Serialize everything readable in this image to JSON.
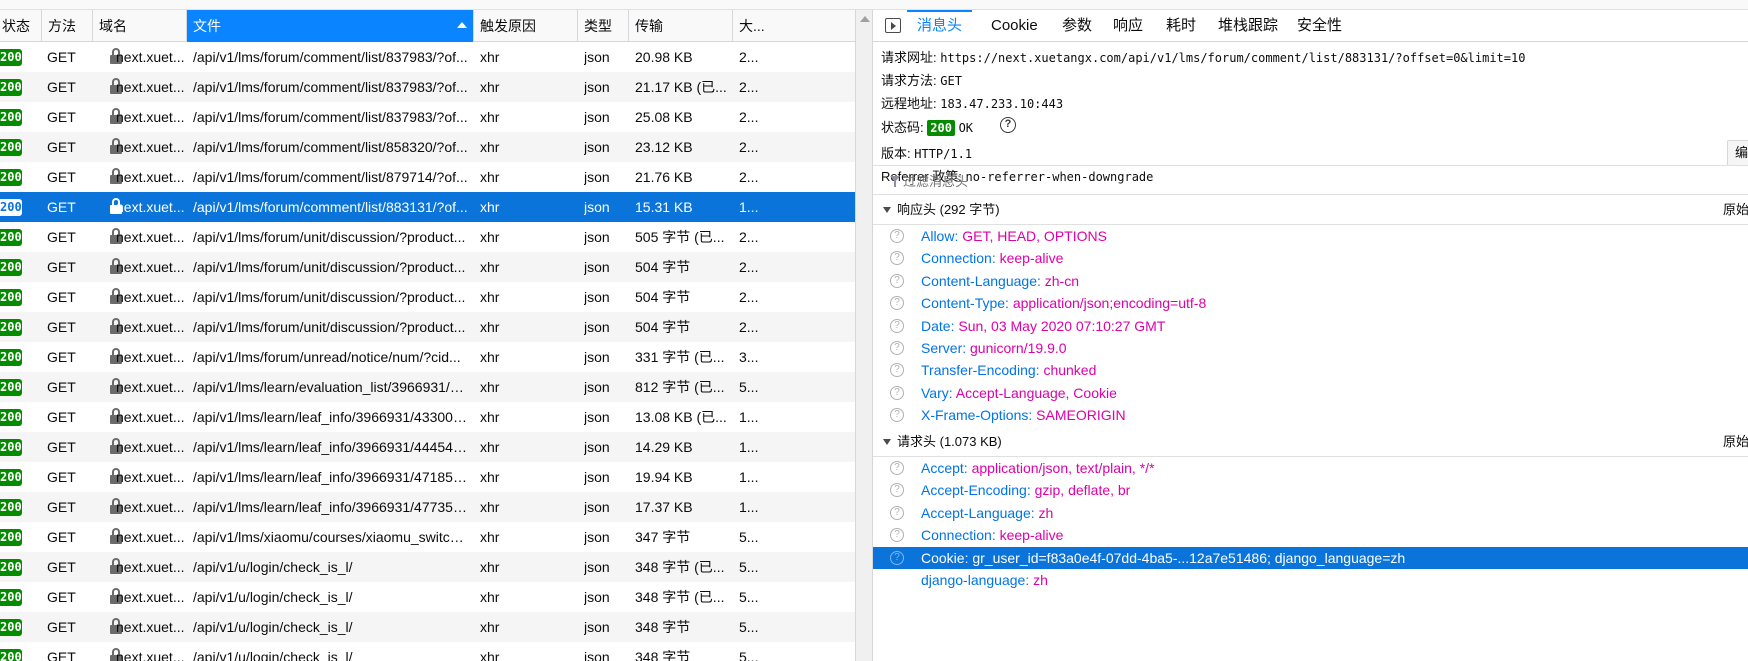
{
  "columns": [
    "状态",
    "方法",
    "域名",
    "文件",
    "触发原因",
    "类型",
    "传输",
    "大..."
  ],
  "requests": [
    {
      "status": "200",
      "method": "GET",
      "domain": "next.xuet...",
      "file": "/api/v1/lms/forum/comment/list/837983/?of...",
      "cause": "xhr",
      "type": "json",
      "transfer": "20.98 KB",
      "size": "2...",
      "selected": false
    },
    {
      "status": "200",
      "method": "GET",
      "domain": "next.xuet...",
      "file": "/api/v1/lms/forum/comment/list/837983/?of...",
      "cause": "xhr",
      "type": "json",
      "transfer": "21.17 KB (已...",
      "size": "2...",
      "selected": false
    },
    {
      "status": "200",
      "method": "GET",
      "domain": "next.xuet...",
      "file": "/api/v1/lms/forum/comment/list/837983/?of...",
      "cause": "xhr",
      "type": "json",
      "transfer": "25.08 KB",
      "size": "2...",
      "selected": false
    },
    {
      "status": "200",
      "method": "GET",
      "domain": "next.xuet...",
      "file": "/api/v1/lms/forum/comment/list/858320/?of...",
      "cause": "xhr",
      "type": "json",
      "transfer": "23.12 KB",
      "size": "2...",
      "selected": false
    },
    {
      "status": "200",
      "method": "GET",
      "domain": "next.xuet...",
      "file": "/api/v1/lms/forum/comment/list/879714/?of...",
      "cause": "xhr",
      "type": "json",
      "transfer": "21.76 KB",
      "size": "2...",
      "selected": false
    },
    {
      "status": "200",
      "method": "GET",
      "domain": "next.xuet...",
      "file": "/api/v1/lms/forum/comment/list/883131/?of...",
      "cause": "xhr",
      "type": "json",
      "transfer": "15.31 KB",
      "size": "1...",
      "selected": true
    },
    {
      "status": "200",
      "method": "GET",
      "domain": "next.xuet...",
      "file": "/api/v1/lms/forum/unit/discussion/?product...",
      "cause": "xhr",
      "type": "json",
      "transfer": "505 字节 (已...",
      "size": "2...",
      "selected": false
    },
    {
      "status": "200",
      "method": "GET",
      "domain": "next.xuet...",
      "file": "/api/v1/lms/forum/unit/discussion/?product...",
      "cause": "xhr",
      "type": "json",
      "transfer": "504 字节",
      "size": "2...",
      "selected": false
    },
    {
      "status": "200",
      "method": "GET",
      "domain": "next.xuet...",
      "file": "/api/v1/lms/forum/unit/discussion/?product...",
      "cause": "xhr",
      "type": "json",
      "transfer": "504 字节",
      "size": "2...",
      "selected": false
    },
    {
      "status": "200",
      "method": "GET",
      "domain": "next.xuet...",
      "file": "/api/v1/lms/forum/unit/discussion/?product...",
      "cause": "xhr",
      "type": "json",
      "transfer": "504 字节",
      "size": "2...",
      "selected": false
    },
    {
      "status": "200",
      "method": "GET",
      "domain": "next.xuet...",
      "file": "/api/v1/lms/forum/unread/notice/num/?cid...",
      "cause": "xhr",
      "type": "json",
      "transfer": "331 字节 (已...",
      "size": "3...",
      "selected": false
    },
    {
      "status": "200",
      "method": "GET",
      "domain": "next.xuet...",
      "file": "/api/v1/lms/learn/evaluation_list/3966931/?c...",
      "cause": "xhr",
      "type": "json",
      "transfer": "812 字节 (已...",
      "size": "5...",
      "selected": false
    },
    {
      "status": "200",
      "method": "GET",
      "domain": "next.xuet...",
      "file": "/api/v1/lms/learn/leaf_info/3966931/433008...",
      "cause": "xhr",
      "type": "json",
      "transfer": "13.08 KB (已...",
      "size": "1...",
      "selected": false
    },
    {
      "status": "200",
      "method": "GET",
      "domain": "next.xuet...",
      "file": "/api/v1/lms/learn/leaf_info/3966931/444541...",
      "cause": "xhr",
      "type": "json",
      "transfer": "14.29 KB",
      "size": "1...",
      "selected": false
    },
    {
      "status": "200",
      "method": "GET",
      "domain": "next.xuet...",
      "file": "/api/v1/lms/learn/leaf_info/3966931/471859...",
      "cause": "xhr",
      "type": "json",
      "transfer": "19.94 KB",
      "size": "1...",
      "selected": false
    },
    {
      "status": "200",
      "method": "GET",
      "domain": "next.xuet...",
      "file": "/api/v1/lms/learn/leaf_info/3966931/477354...",
      "cause": "xhr",
      "type": "json",
      "transfer": "17.37 KB",
      "size": "1...",
      "selected": false
    },
    {
      "status": "200",
      "method": "GET",
      "domain": "next.xuet...",
      "file": "/api/v1/lms/xiaomu/courses/xiaomu_switch/...",
      "cause": "xhr",
      "type": "json",
      "transfer": "347 字节",
      "size": "5...",
      "selected": false
    },
    {
      "status": "200",
      "method": "GET",
      "domain": "next.xuet...",
      "file": "/api/v1/u/login/check_is_l/",
      "cause": "xhr",
      "type": "json",
      "transfer": "348 字节 (已...",
      "size": "5...",
      "selected": false
    },
    {
      "status": "200",
      "method": "GET",
      "domain": "next.xuet...",
      "file": "/api/v1/u/login/check_is_l/",
      "cause": "xhr",
      "type": "json",
      "transfer": "348 字节 (已...",
      "size": "5...",
      "selected": false
    },
    {
      "status": "200",
      "method": "GET",
      "domain": "next.xuet...",
      "file": "/api/v1/u/login/check_is_l/",
      "cause": "xhr",
      "type": "json",
      "transfer": "348 字节",
      "size": "5...",
      "selected": false
    },
    {
      "status": "200",
      "method": "GET",
      "domain": "next.xuet...",
      "file": "/api/v1/u/login/check_is_l/",
      "cause": "xhr",
      "type": "json",
      "transfer": "348 字节",
      "size": "5...",
      "selected": false
    }
  ],
  "tabs": [
    "消息头",
    "Cookie",
    "参数",
    "响应",
    "耗时",
    "堆栈跟踪",
    "安全性"
  ],
  "summary": {
    "url_label": "请求网址:",
    "url": "https://next.xuetangx.com/api/v1/lms/forum/comment/list/883131/?offset=0&limit=10",
    "method_label": "请求方法:",
    "method": "GET",
    "remote_label": "远程地址:",
    "remote": "183.47.233.10:443",
    "status_label": "状态码:",
    "status_code": "200",
    "status_text": "OK",
    "version_label": "版本:",
    "version": "HTTP/1.1",
    "referrer_label": "Referrer 政策:",
    "referrer": "no-referrer-when-downgrade",
    "edit_label": "编"
  },
  "filter_placeholder": "过滤消息头",
  "response_section": {
    "title": "响应头 (292 字节)",
    "raw": "原始"
  },
  "response_headers": [
    {
      "name": "Allow:",
      "value": "GET, HEAD, OPTIONS"
    },
    {
      "name": "Connection:",
      "value": "keep-alive"
    },
    {
      "name": "Content-Language:",
      "value": "zh-cn"
    },
    {
      "name": "Content-Type:",
      "value": "application/json;encoding=utf-8"
    },
    {
      "name": "Date:",
      "value": "Sun, 03 May 2020 07:10:27 GMT"
    },
    {
      "name": "Server:",
      "value": "gunicorn/19.9.0"
    },
    {
      "name": "Transfer-Encoding:",
      "value": "chunked"
    },
    {
      "name": "Vary:",
      "value": "Accept-Language, Cookie"
    },
    {
      "name": "X-Frame-Options:",
      "value": "SAMEORIGIN"
    }
  ],
  "request_section": {
    "title": "请求头 (1.073 KB)",
    "raw": "原始"
  },
  "request_headers": [
    {
      "name": "Accept:",
      "value": "application/json, text/plain, */*",
      "selected": false
    },
    {
      "name": "Accept-Encoding:",
      "value": "gzip, deflate, br",
      "selected": false
    },
    {
      "name": "Accept-Language:",
      "value": "zh",
      "selected": false
    },
    {
      "name": "Connection:",
      "value": "keep-alive",
      "selected": false
    },
    {
      "name": "Cookie:",
      "value": "gr_user_id=f83a0e4f-07dd-4ba5-...12a7e51486; django_language=zh",
      "selected": true
    },
    {
      "name": "django-language:",
      "value": "zh",
      "selected": false,
      "sub": true
    }
  ]
}
